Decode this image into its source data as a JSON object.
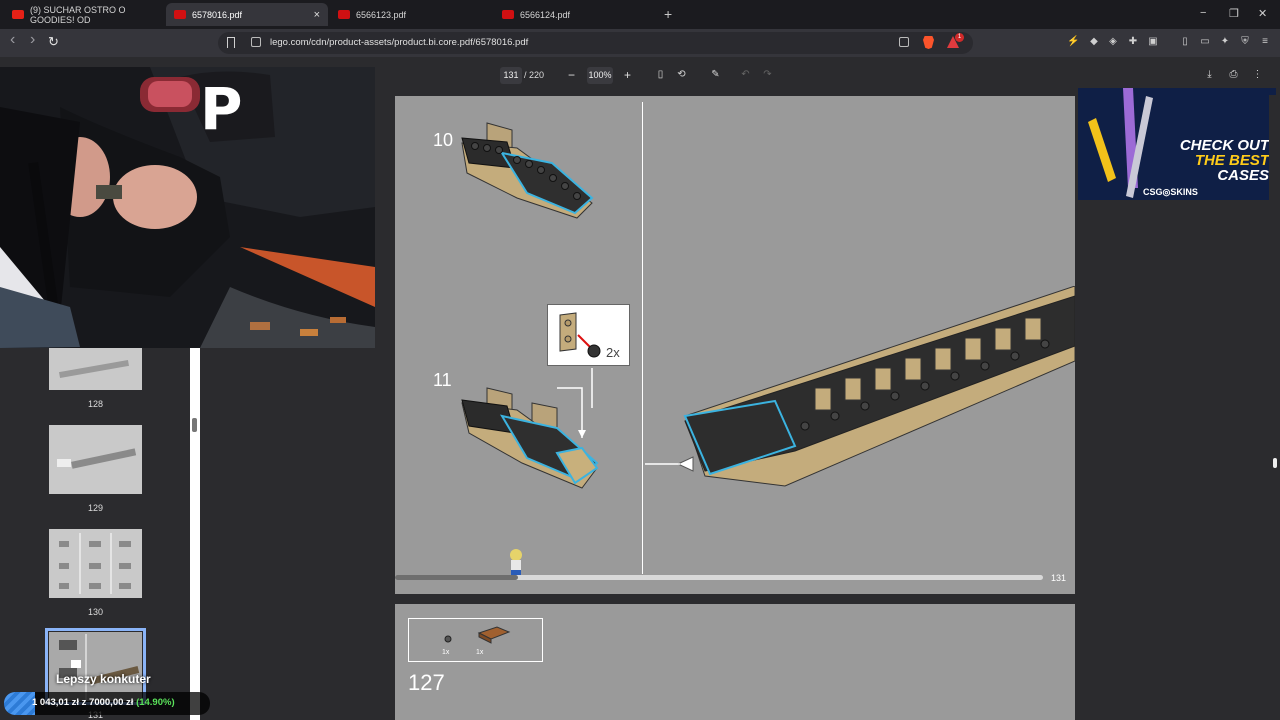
{
  "browser": {
    "tabs": [
      {
        "title": "(9) SUCHAR OSTRO O GOODIES! OD",
        "favicon": "youtube-icon",
        "active": false
      },
      {
        "title": "6578016.pdf",
        "favicon": "lego-icon",
        "active": true
      },
      {
        "title": "6566123.pdf",
        "favicon": "lego-icon",
        "active": false
      },
      {
        "title": "6566124.pdf",
        "favicon": "lego-icon",
        "active": false
      }
    ],
    "tab_close": "×",
    "new_tab": "+",
    "window_controls": {
      "minimize": "−",
      "restore": "❐",
      "close": "✕"
    },
    "nav": {
      "back": "‹",
      "forward": "›",
      "reload": "↻"
    },
    "url": "lego.com/cdn/product-assets/product.bi.core.pdf/6578016.pdf",
    "rewards_badge": "1"
  },
  "pdf_toolbar": {
    "current_page": "131",
    "total_pages": "/ 220",
    "zoom_out": "−",
    "zoom": "100%",
    "zoom_in": "+"
  },
  "sidebar": {
    "thumbnails": [
      {
        "label": "128"
      },
      {
        "label": "129"
      },
      {
        "label": "130"
      },
      {
        "label": "131",
        "selected": true
      }
    ]
  },
  "page": {
    "step_10": "10",
    "step_11": "11",
    "callout_qty": "2x",
    "page_number": "131",
    "progress": 0.19
  },
  "next_page": {
    "parts": [
      {
        "qty": "1x"
      },
      {
        "qty": "1x"
      }
    ],
    "step_number": "127"
  },
  "ad": {
    "line1": "CHECK OUT",
    "line2": "THE BEST",
    "line3": "CASES",
    "brand": "CSG◎SKINS"
  },
  "stream_overlay": {
    "title": "Lepszy konkuter",
    "raised": "1 043,01 zł",
    "of": "z",
    "goal": "7000,00 zł",
    "percent": "(14.90%)",
    "progress": 0.149
  },
  "colors": {
    "accent": "#8ab4f8",
    "lego_red": "#d01012",
    "brave": "#fb542b",
    "donation_green": "#5be35b"
  }
}
